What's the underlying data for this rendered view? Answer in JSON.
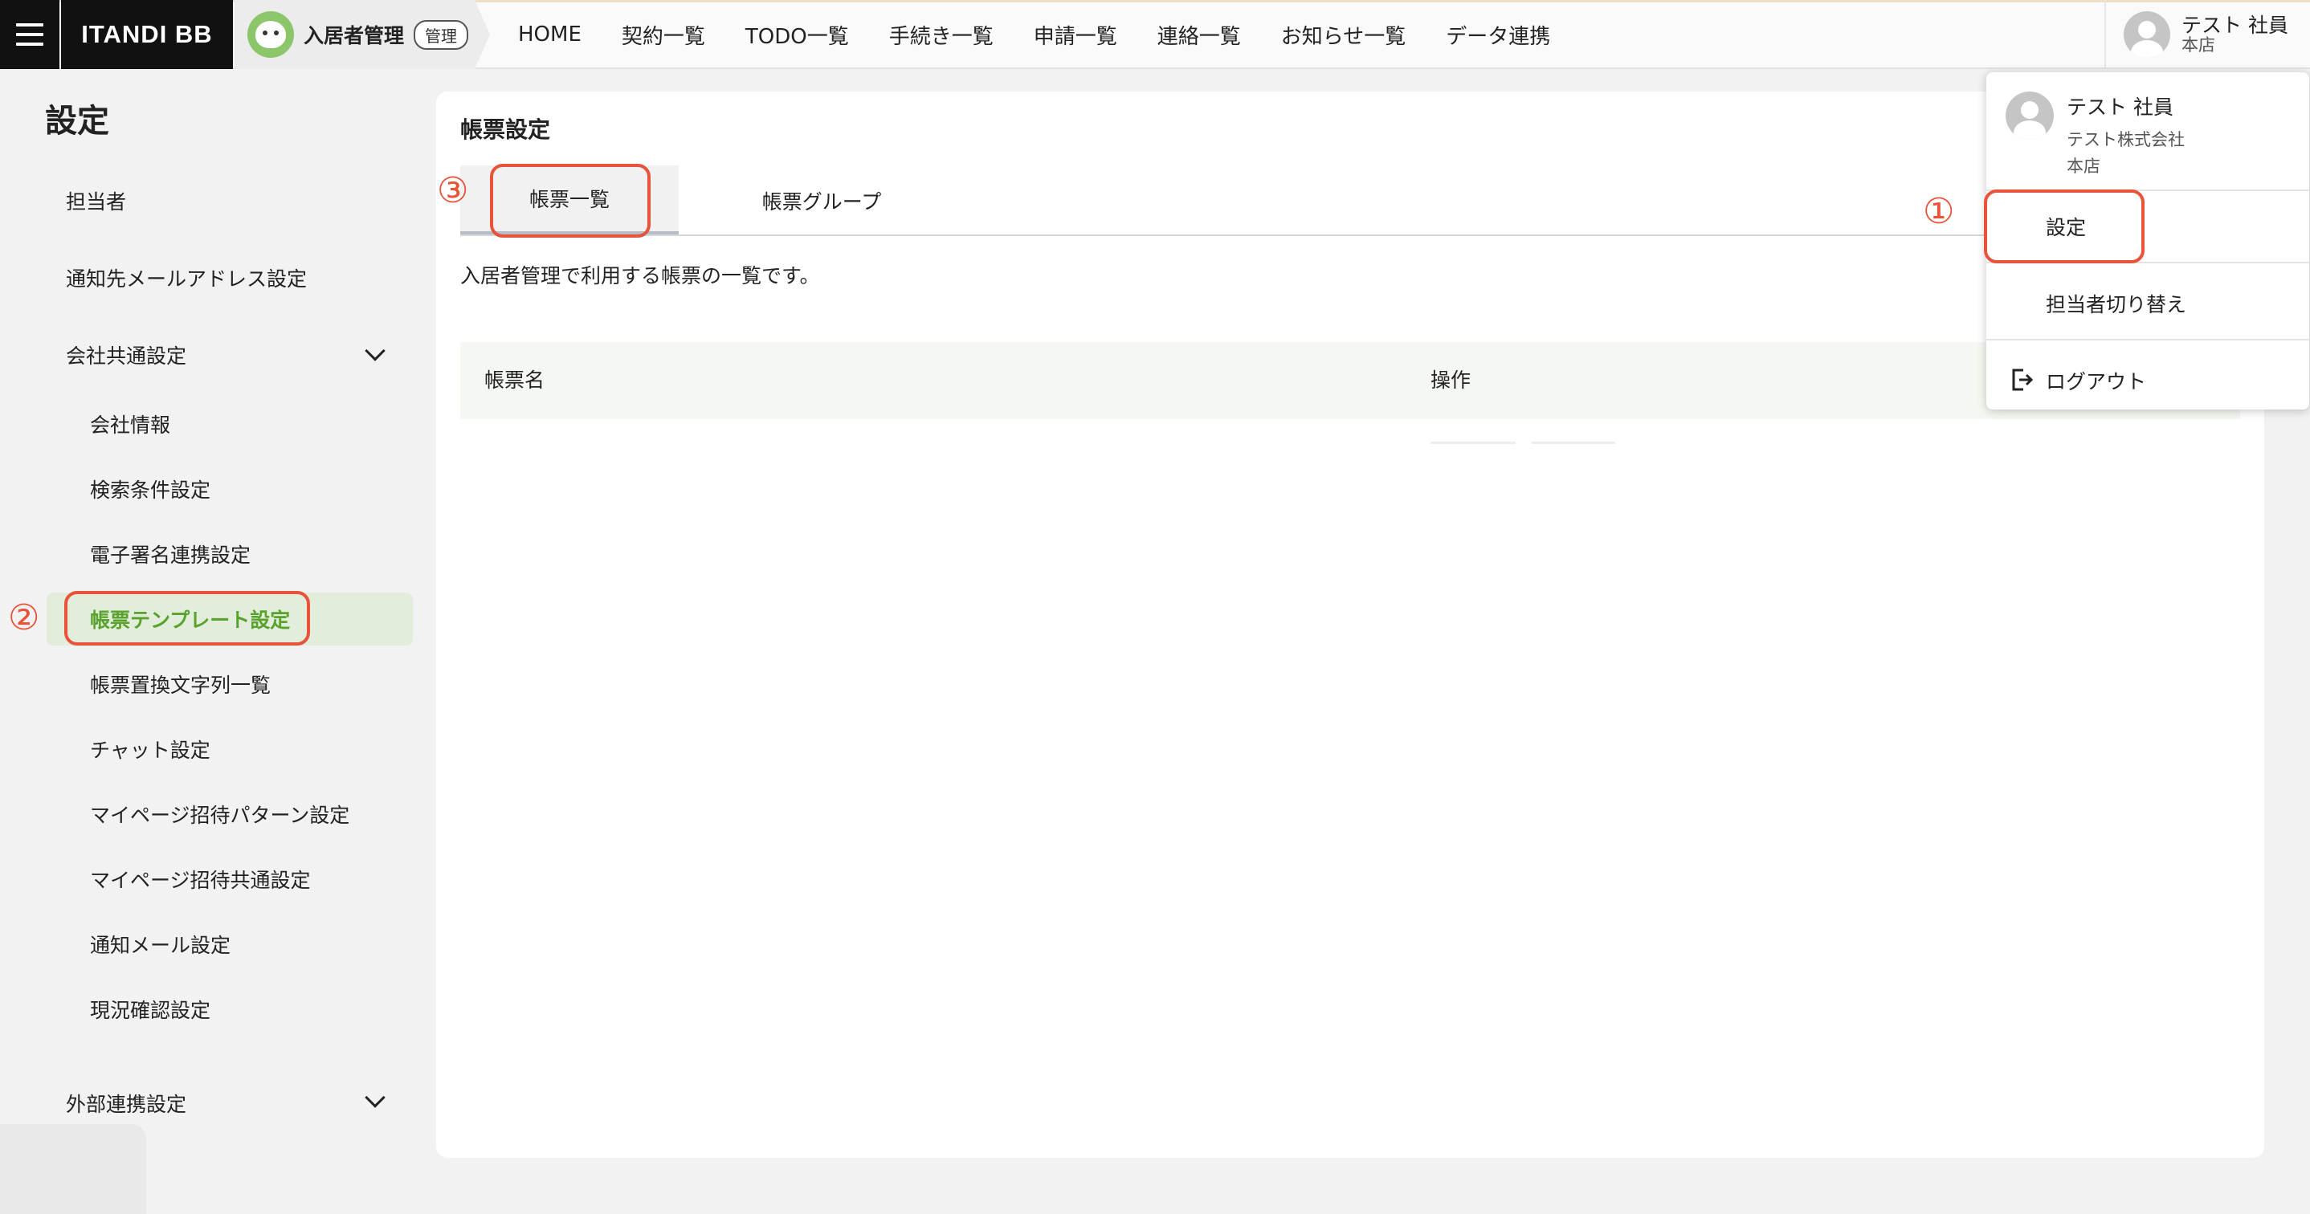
{
  "header": {
    "brand": "ITANDI BB",
    "app_name": "入居者管理",
    "app_badge": "管理",
    "nav": [
      "HOME",
      "契約一覧",
      "TODO一覧",
      "手続き一覧",
      "申請一覧",
      "連絡一覧",
      "お知らせ一覧",
      "データ連携"
    ],
    "user_name": "テスト 社員",
    "user_branch": "本店"
  },
  "sidebar": {
    "title": "設定",
    "items": [
      {
        "label": "担当者"
      },
      {
        "label": "通知先メールアドレス設定"
      },
      {
        "label": "会社共通設定"
      },
      {
        "label": "会社情報"
      },
      {
        "label": "検索条件設定"
      },
      {
        "label": "電子署名連携設定"
      },
      {
        "label": "帳票テンプレート設定"
      },
      {
        "label": "帳票置換文字列一覧"
      },
      {
        "label": "チャット設定"
      },
      {
        "label": "マイページ招待パターン設定"
      },
      {
        "label": "マイページ招待共通設定"
      },
      {
        "label": "通知メール設定"
      },
      {
        "label": "現況確認設定"
      },
      {
        "label": "外部連携設定"
      }
    ]
  },
  "main": {
    "title": "帳票設定",
    "tabs": [
      {
        "label": "帳票一覧"
      },
      {
        "label": "帳票グループ"
      }
    ],
    "description": "入居者管理で利用する帳票の一覧です。",
    "table": {
      "columns": [
        "帳票名",
        "操作"
      ]
    }
  },
  "dropdown": {
    "user_name": "テスト 社員",
    "company": "テスト株式会社",
    "branch": "本店",
    "items": [
      {
        "label": "設定"
      },
      {
        "label": "担当者切り替え"
      },
      {
        "label": "ログアウト"
      }
    ]
  },
  "annotations": {
    "n1": "①",
    "n2": "②",
    "n3": "③"
  },
  "colors": {
    "accent": "#5aa22e",
    "annotation": "#e8533a",
    "active_bg": "#e2eedb"
  }
}
